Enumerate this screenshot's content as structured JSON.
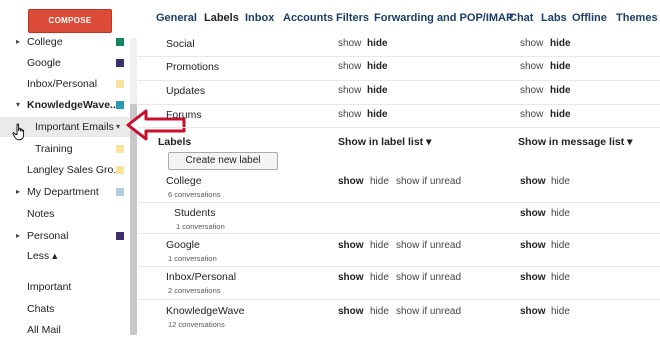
{
  "compose_label": "COMPOSE",
  "sidebar": {
    "items": [
      {
        "label": "College",
        "color": "#16865f",
        "arrow": "▸"
      },
      {
        "label": "Google",
        "color": "#3d2d6b"
      },
      {
        "label": "Inbox/Personal",
        "color": "#f8e49c"
      },
      {
        "label": "KnowledgeWave...",
        "color": "#2b9bb4",
        "arrow": "▾"
      },
      {
        "label": "Important Emails",
        "dropdown": "▾"
      },
      {
        "label": "Training",
        "color": "#f8e49c"
      },
      {
        "label": "Langley Sales Gro...",
        "color": "#f8e49c"
      },
      {
        "label": "My Department",
        "color": "#b0cde8",
        "arrow": "▸"
      },
      {
        "label": "Notes"
      },
      {
        "label": "Personal",
        "color": "#3d2d6b",
        "arrow": "▸"
      },
      {
        "label": "Less ▴"
      },
      {
        "label": "Important"
      },
      {
        "label": "Chats"
      },
      {
        "label": "All Mail"
      }
    ]
  },
  "tabs": [
    {
      "label": "General"
    },
    {
      "label": "Labels",
      "active": true
    },
    {
      "label": "Inbox"
    },
    {
      "label": "Accounts"
    },
    {
      "label": "Filters"
    },
    {
      "label": "Forwarding and POP/IMAP"
    },
    {
      "label": "Chat"
    },
    {
      "label": "Labs"
    },
    {
      "label": "Offline"
    },
    {
      "label": "Themes"
    }
  ],
  "categories": [
    {
      "name": "Social",
      "show": "show",
      "hide": "hide",
      "show2": "show",
      "hide2": "hide"
    },
    {
      "name": "Promotions",
      "show": "show",
      "hide": "hide",
      "show2": "show",
      "hide2": "hide"
    },
    {
      "name": "Updates",
      "show": "show",
      "hide": "hide",
      "show2": "show",
      "hide2": "hide"
    },
    {
      "name": "Forums",
      "show": "show",
      "hide": "hide",
      "show2": "show",
      "hide2": "hide"
    }
  ],
  "labels_header": {
    "title": "Labels",
    "col1": "Show in label list ▾",
    "col2": "Show in message list ▾",
    "create_button": "Create new label"
  },
  "labels": [
    {
      "name": "College",
      "sub": "6 conversations",
      "show": "show",
      "hide": "hide",
      "unread": "show if unread",
      "show2": "show",
      "hide2": "hide"
    },
    {
      "name": "Students",
      "sub": "1 conversation",
      "show2": "show",
      "hide2": "hide"
    },
    {
      "name": "Google",
      "sub": "1 conversation",
      "show": "show",
      "hide": "hide",
      "unread": "show if unread",
      "show2": "show",
      "hide2": "hide"
    },
    {
      "name": "Inbox/Personal",
      "sub": "2 conversations",
      "show": "show",
      "hide": "hide",
      "unread": "show if unread",
      "show2": "show",
      "hide2": "hide"
    },
    {
      "name": "KnowledgeWave",
      "sub": "12 conversations",
      "show": "show",
      "hide": "hide",
      "unread": "show if unread",
      "show2": "show",
      "hide2": "hide"
    }
  ]
}
